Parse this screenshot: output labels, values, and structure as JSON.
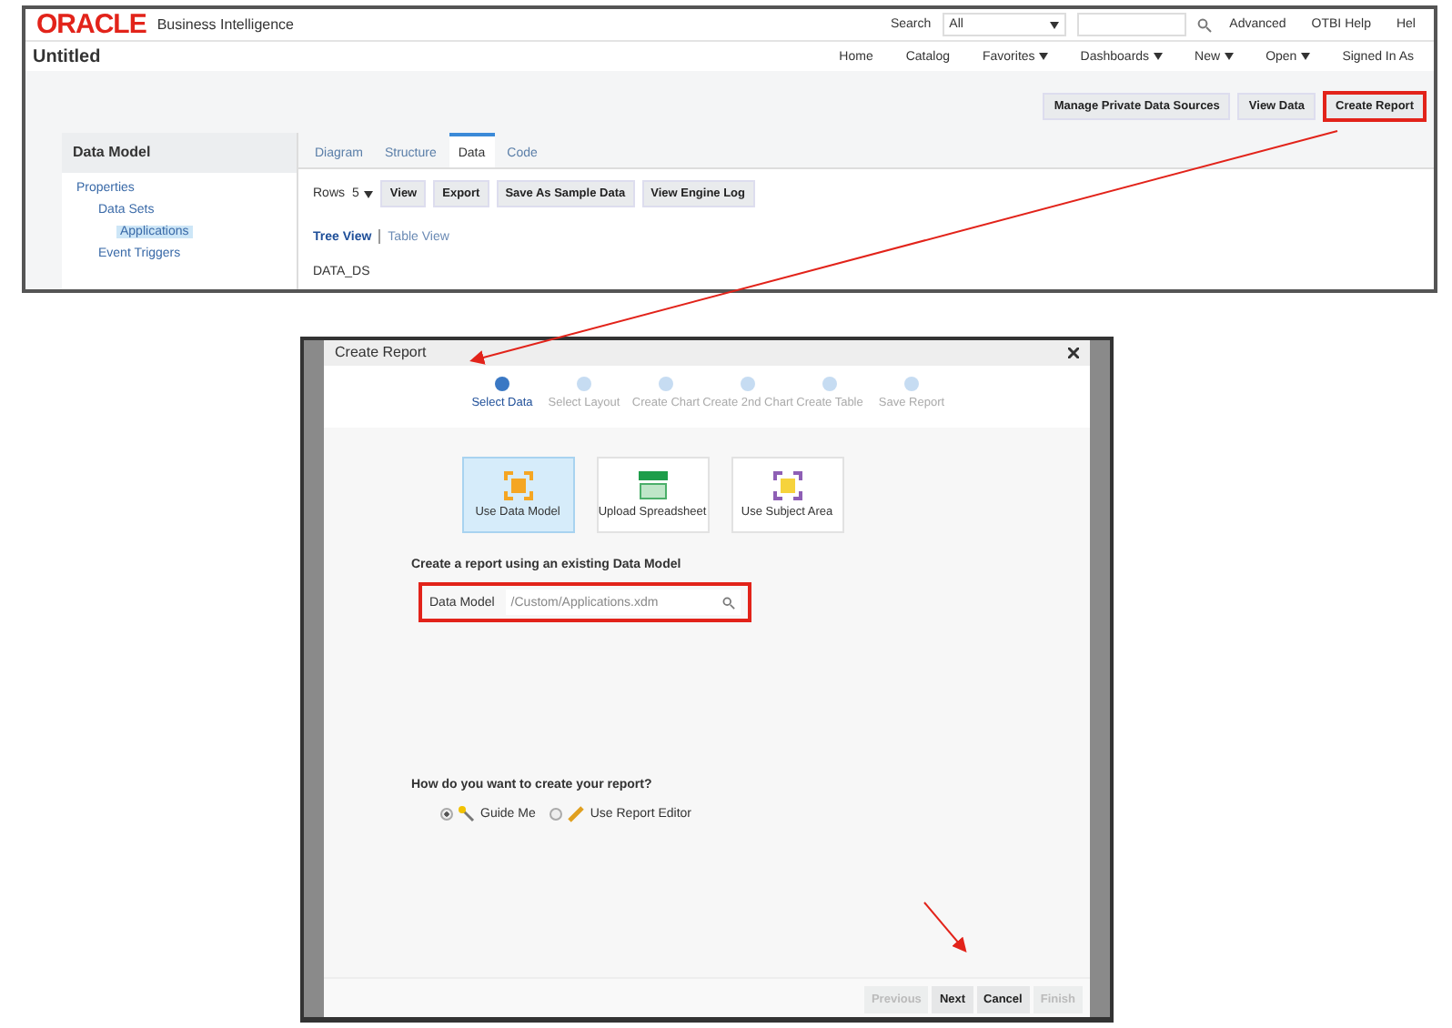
{
  "top_screen": {
    "logo": "ORACLE",
    "product": "Business Intelligence",
    "search_label": "Search",
    "search_scope": "All",
    "header_links": [
      "Advanced",
      "OTBI Help",
      "Hel"
    ],
    "page_title": "Untitled",
    "nav": [
      {
        "label": "Home",
        "menu": false
      },
      {
        "label": "Catalog",
        "menu": false
      },
      {
        "label": "Favorites",
        "menu": true
      },
      {
        "label": "Dashboards",
        "menu": true
      },
      {
        "label": "New",
        "menu": true
      },
      {
        "label": "Open",
        "menu": true
      },
      {
        "label": "Signed In As",
        "menu": false
      }
    ],
    "actions": [
      {
        "label": "Manage Private Data Sources",
        "highlighted": false
      },
      {
        "label": "View Data",
        "highlighted": false
      },
      {
        "label": "Create Report",
        "highlighted": true
      }
    ],
    "panel_title": "Data Model",
    "tree": [
      {
        "label": "Properties",
        "selected": false,
        "children": [
          {
            "label": "Data Sets",
            "selected": false,
            "children": [
              {
                "label": "Applications",
                "selected": true
              }
            ]
          },
          {
            "label": "Event Triggers",
            "selected": false
          }
        ]
      }
    ],
    "tabs": [
      {
        "label": "Diagram",
        "selected": false
      },
      {
        "label": "Structure",
        "selected": false
      },
      {
        "label": "Data",
        "selected": true
      },
      {
        "label": "Code",
        "selected": false
      }
    ],
    "rows_label": "Rows",
    "rows_value": "5",
    "toolbar": [
      "View",
      "Export",
      "Save As Sample Data",
      "View Engine Log"
    ],
    "views": [
      {
        "label": "Tree View",
        "selected": true
      },
      {
        "label": "Table View",
        "selected": false
      }
    ],
    "data_root": "DATA_DS"
  },
  "dialog": {
    "title": "Create Report",
    "steps": [
      {
        "label": "Select Data",
        "selected": true
      },
      {
        "label": "Select Layout",
        "selected": false
      },
      {
        "label": "Create Chart",
        "selected": false
      },
      {
        "label": "Create 2nd Chart",
        "selected": false
      },
      {
        "label": "Create Table",
        "selected": false
      },
      {
        "label": "Save Report",
        "selected": false
      }
    ],
    "sources": [
      {
        "label": "Use Data Model",
        "kind": "model",
        "selected": true
      },
      {
        "label": "Upload Spreadsheet",
        "kind": "sheet",
        "selected": false
      },
      {
        "label": "Use Subject Area",
        "kind": "subject",
        "selected": false
      }
    ],
    "prompt": "Create a report using an existing Data Model",
    "field_label": "Data Model",
    "field_value": "/Custom/Applications.xdm",
    "field_highlighted": true,
    "question": "How do you want to create your report?",
    "modes": [
      {
        "label": "Guide Me",
        "kind": "guide",
        "selected": true
      },
      {
        "label": "Use Report Editor",
        "kind": "editor",
        "selected": false
      }
    ],
    "buttons": [
      {
        "label": "Previous",
        "disabled": true
      },
      {
        "label": "Next",
        "disabled": false
      },
      {
        "label": "Cancel",
        "disabled": false
      },
      {
        "label": "Finish",
        "disabled": true
      }
    ]
  }
}
